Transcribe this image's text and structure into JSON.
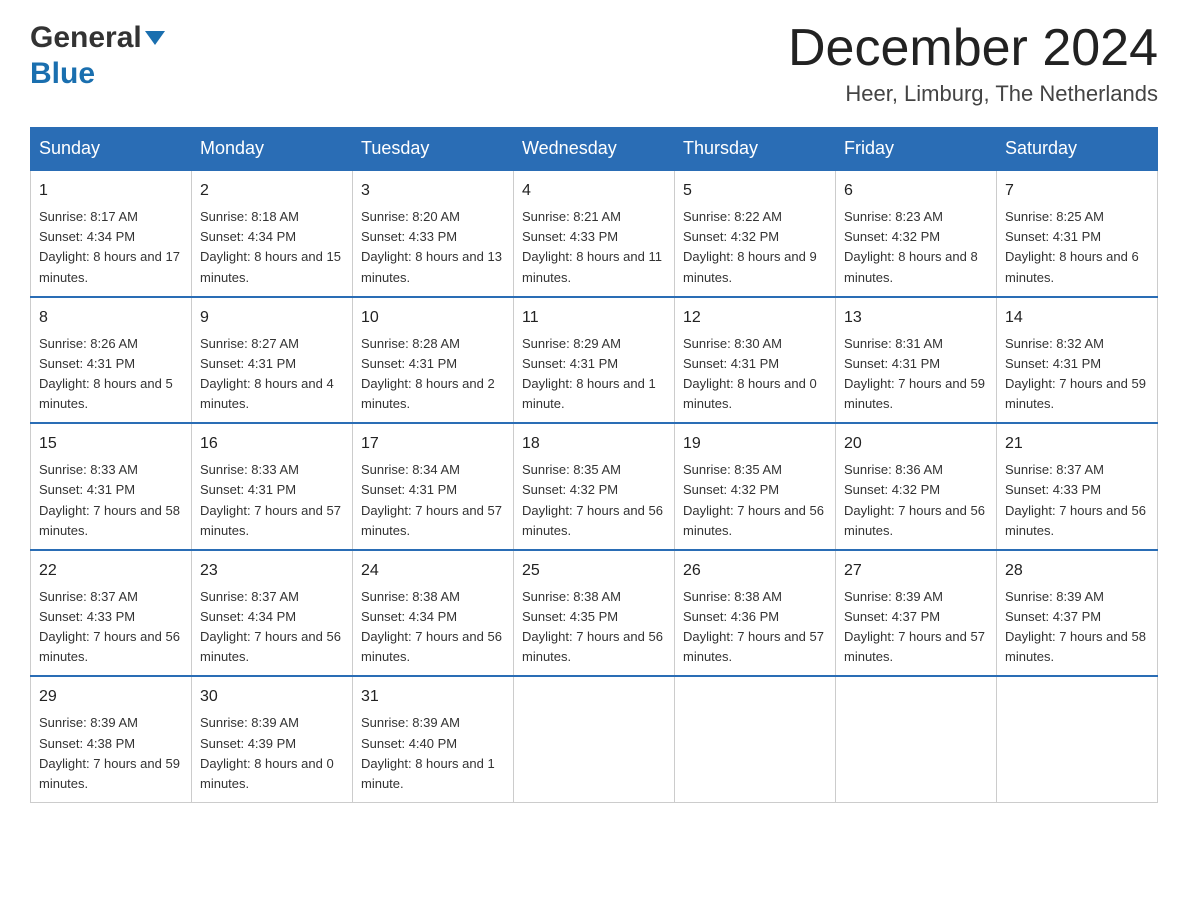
{
  "header": {
    "month_year": "December 2024",
    "location": "Heer, Limburg, The Netherlands",
    "logo_general": "General",
    "logo_blue": "Blue"
  },
  "days_of_week": [
    "Sunday",
    "Monday",
    "Tuesday",
    "Wednesday",
    "Thursday",
    "Friday",
    "Saturday"
  ],
  "weeks": [
    [
      {
        "day": "1",
        "sunrise": "8:17 AM",
        "sunset": "4:34 PM",
        "daylight": "8 hours and 17 minutes."
      },
      {
        "day": "2",
        "sunrise": "8:18 AM",
        "sunset": "4:34 PM",
        "daylight": "8 hours and 15 minutes."
      },
      {
        "day": "3",
        "sunrise": "8:20 AM",
        "sunset": "4:33 PM",
        "daylight": "8 hours and 13 minutes."
      },
      {
        "day": "4",
        "sunrise": "8:21 AM",
        "sunset": "4:33 PM",
        "daylight": "8 hours and 11 minutes."
      },
      {
        "day": "5",
        "sunrise": "8:22 AM",
        "sunset": "4:32 PM",
        "daylight": "8 hours and 9 minutes."
      },
      {
        "day": "6",
        "sunrise": "8:23 AM",
        "sunset": "4:32 PM",
        "daylight": "8 hours and 8 minutes."
      },
      {
        "day": "7",
        "sunrise": "8:25 AM",
        "sunset": "4:31 PM",
        "daylight": "8 hours and 6 minutes."
      }
    ],
    [
      {
        "day": "8",
        "sunrise": "8:26 AM",
        "sunset": "4:31 PM",
        "daylight": "8 hours and 5 minutes."
      },
      {
        "day": "9",
        "sunrise": "8:27 AM",
        "sunset": "4:31 PM",
        "daylight": "8 hours and 4 minutes."
      },
      {
        "day": "10",
        "sunrise": "8:28 AM",
        "sunset": "4:31 PM",
        "daylight": "8 hours and 2 minutes."
      },
      {
        "day": "11",
        "sunrise": "8:29 AM",
        "sunset": "4:31 PM",
        "daylight": "8 hours and 1 minute."
      },
      {
        "day": "12",
        "sunrise": "8:30 AM",
        "sunset": "4:31 PM",
        "daylight": "8 hours and 0 minutes."
      },
      {
        "day": "13",
        "sunrise": "8:31 AM",
        "sunset": "4:31 PM",
        "daylight": "7 hours and 59 minutes."
      },
      {
        "day": "14",
        "sunrise": "8:32 AM",
        "sunset": "4:31 PM",
        "daylight": "7 hours and 59 minutes."
      }
    ],
    [
      {
        "day": "15",
        "sunrise": "8:33 AM",
        "sunset": "4:31 PM",
        "daylight": "7 hours and 58 minutes."
      },
      {
        "day": "16",
        "sunrise": "8:33 AM",
        "sunset": "4:31 PM",
        "daylight": "7 hours and 57 minutes."
      },
      {
        "day": "17",
        "sunrise": "8:34 AM",
        "sunset": "4:31 PM",
        "daylight": "7 hours and 57 minutes."
      },
      {
        "day": "18",
        "sunrise": "8:35 AM",
        "sunset": "4:32 PM",
        "daylight": "7 hours and 56 minutes."
      },
      {
        "day": "19",
        "sunrise": "8:35 AM",
        "sunset": "4:32 PM",
        "daylight": "7 hours and 56 minutes."
      },
      {
        "day": "20",
        "sunrise": "8:36 AM",
        "sunset": "4:32 PM",
        "daylight": "7 hours and 56 minutes."
      },
      {
        "day": "21",
        "sunrise": "8:37 AM",
        "sunset": "4:33 PM",
        "daylight": "7 hours and 56 minutes."
      }
    ],
    [
      {
        "day": "22",
        "sunrise": "8:37 AM",
        "sunset": "4:33 PM",
        "daylight": "7 hours and 56 minutes."
      },
      {
        "day": "23",
        "sunrise": "8:37 AM",
        "sunset": "4:34 PM",
        "daylight": "7 hours and 56 minutes."
      },
      {
        "day": "24",
        "sunrise": "8:38 AM",
        "sunset": "4:34 PM",
        "daylight": "7 hours and 56 minutes."
      },
      {
        "day": "25",
        "sunrise": "8:38 AM",
        "sunset": "4:35 PM",
        "daylight": "7 hours and 56 minutes."
      },
      {
        "day": "26",
        "sunrise": "8:38 AM",
        "sunset": "4:36 PM",
        "daylight": "7 hours and 57 minutes."
      },
      {
        "day": "27",
        "sunrise": "8:39 AM",
        "sunset": "4:37 PM",
        "daylight": "7 hours and 57 minutes."
      },
      {
        "day": "28",
        "sunrise": "8:39 AM",
        "sunset": "4:37 PM",
        "daylight": "7 hours and 58 minutes."
      }
    ],
    [
      {
        "day": "29",
        "sunrise": "8:39 AM",
        "sunset": "4:38 PM",
        "daylight": "7 hours and 59 minutes."
      },
      {
        "day": "30",
        "sunrise": "8:39 AM",
        "sunset": "4:39 PM",
        "daylight": "8 hours and 0 minutes."
      },
      {
        "day": "31",
        "sunrise": "8:39 AM",
        "sunset": "4:40 PM",
        "daylight": "8 hours and 1 minute."
      },
      null,
      null,
      null,
      null
    ]
  ],
  "colors": {
    "header_bg": "#2a6db5",
    "header_text": "#ffffff",
    "border": "#2a6db5"
  }
}
